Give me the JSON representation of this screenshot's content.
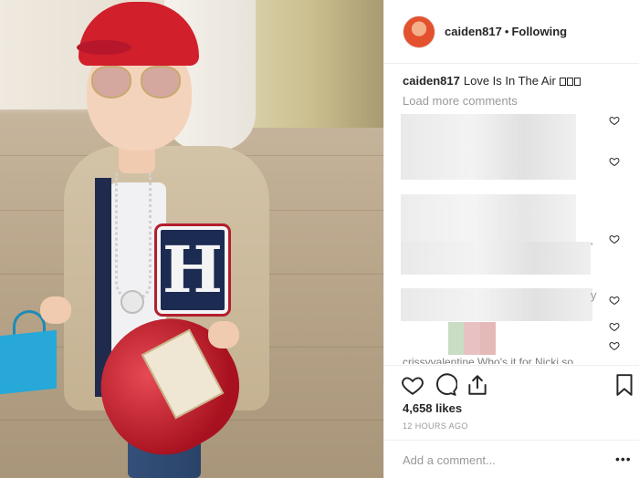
{
  "header": {
    "username": "caiden817",
    "separator": "•",
    "follow_status": "Following"
  },
  "caption": {
    "username": "caiden817",
    "text": "Love Is In The Air"
  },
  "comments": {
    "load_more": "Load more comments",
    "partial_letter_y": "y",
    "partial_letter_t": "'",
    "cut_text": "crissyvalentine Who's it for Nicki so"
  },
  "actions": {
    "likes": "4,658 likes",
    "timestamp": "12 HOURS AGO"
  },
  "add_comment": {
    "placeholder": "Add a comment...",
    "more_label": "•••"
  },
  "icons": {
    "like": "heart-outline-icon",
    "comment": "comment-bubble-icon",
    "share": "share-icon",
    "save": "bookmark-icon",
    "comment_like": "heart-small-icon"
  },
  "colors": {
    "text": "#262626",
    "muted": "#999999",
    "divider": "#efefef"
  }
}
